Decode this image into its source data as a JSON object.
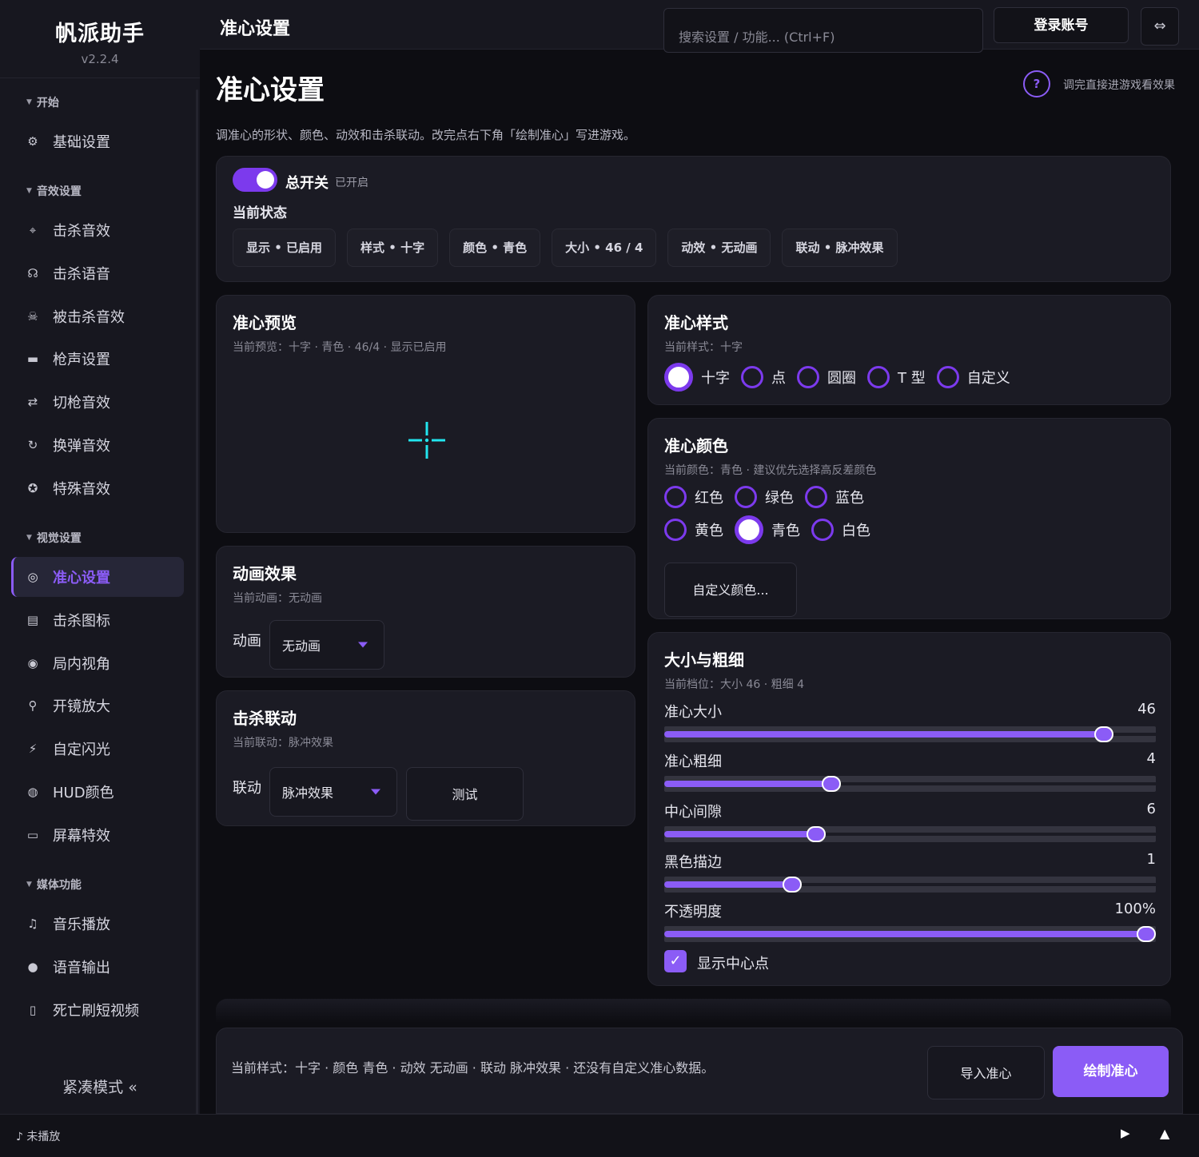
{
  "app": {
    "name": "帆派助手",
    "version": "v2.2.4"
  },
  "topbar": {
    "title": "准心设置",
    "search_placeholder": "搜索设置 / 功能...  (Ctrl+F)",
    "login": "登录账号",
    "swap_icon": "⇔"
  },
  "sidebar": {
    "sections": [
      {
        "label": "开始",
        "items": [
          {
            "icon": "gear-icon",
            "glyph": "⚙",
            "label": "基础设置"
          }
        ]
      },
      {
        "label": "音效设置",
        "items": [
          {
            "icon": "target-icon",
            "glyph": "⌖",
            "label": "击杀音效"
          },
          {
            "icon": "voice-icon",
            "glyph": "☊",
            "label": "击杀语音"
          },
          {
            "icon": "skull-icon",
            "glyph": "☠",
            "label": "被击杀音效"
          },
          {
            "icon": "gun-icon",
            "glyph": "▬",
            "label": "枪声设置"
          },
          {
            "icon": "swap-icon",
            "glyph": "⇄",
            "label": "切枪音效"
          },
          {
            "icon": "reload-icon",
            "glyph": "↻",
            "label": "换弹音效"
          },
          {
            "icon": "star-icon",
            "glyph": "✪",
            "label": "特殊音效"
          }
        ]
      },
      {
        "label": "视觉设置",
        "items": [
          {
            "icon": "crosshair-icon",
            "glyph": "◎",
            "label": "准心设置",
            "active": true
          },
          {
            "icon": "image-icon",
            "glyph": "▤",
            "label": "击杀图标"
          },
          {
            "icon": "eye-icon",
            "glyph": "◉",
            "label": "局内视角"
          },
          {
            "icon": "magnify-icon",
            "glyph": "⚲",
            "label": "开镜放大"
          },
          {
            "icon": "flash-icon",
            "glyph": "⚡",
            "label": "自定闪光"
          },
          {
            "icon": "palette-icon",
            "glyph": "◍",
            "label": "HUD颜色"
          },
          {
            "icon": "monitor-icon",
            "glyph": "▭",
            "label": "屏幕特效"
          }
        ]
      },
      {
        "label": "媒体功能",
        "items": [
          {
            "icon": "music-icon",
            "glyph": "♫",
            "label": "音乐播放"
          },
          {
            "icon": "mic-icon",
            "glyph": "●",
            "label": "语音输出"
          },
          {
            "icon": "phone-icon",
            "glyph": "▯",
            "label": "死亡刷短视频"
          }
        ]
      }
    ],
    "compact_mode": "紧凑模式  «"
  },
  "page": {
    "heading": "准心设置",
    "help_icon": "?",
    "help_text": "调完直接进游戏看效果",
    "description": "调准心的形状、颜色、动效和击杀联动。改完点右下角「绘制准心」写进游戏。"
  },
  "master": {
    "label": "总开关",
    "state": "已开启",
    "enabled": true,
    "status_label": "当前状态",
    "chips": [
      "显示 • 已启用",
      "样式 • 十字",
      "颜色 • 青色",
      "大小 • 46 / 4",
      "动效 • 无动画",
      "联动 • 脉冲效果"
    ]
  },
  "preview": {
    "title": "准心预览",
    "subtitle": "当前预览：十字 · 青色 · 46/4 · 显示已启用",
    "color": "#22e5ee"
  },
  "style": {
    "title": "准心样式",
    "subtitle": "当前样式：十字",
    "options": [
      "十字",
      "点",
      "圆圈",
      "T 型",
      "自定义"
    ],
    "selected": "十字"
  },
  "color": {
    "title": "准心颜色",
    "subtitle": "当前颜色：青色 · 建议优先选择高反差颜色",
    "row1": [
      "红色",
      "绿色",
      "蓝色"
    ],
    "row2": [
      "黄色",
      "青色",
      "白色"
    ],
    "selected": "青色",
    "custom_button": "自定义颜色..."
  },
  "animation": {
    "title": "动画效果",
    "subtitle": "当前动画：无动画",
    "field_label": "动画",
    "value": "无动画"
  },
  "kill_link": {
    "title": "击杀联动",
    "subtitle": "当前联动：脉冲效果",
    "field_label": "联动",
    "value": "脉冲效果",
    "test_button": "测试"
  },
  "size": {
    "title": "大小与粗细",
    "subtitle": "当前档位：大小 46 · 粗细 4",
    "sliders": [
      {
        "name": "准心大小",
        "value": "46",
        "fraction": 0.895
      },
      {
        "name": "准心粗细",
        "value": "4",
        "fraction": 0.34
      },
      {
        "name": "中心间隙",
        "value": "6",
        "fraction": 0.309
      },
      {
        "name": "黑色描边",
        "value": "1",
        "fraction": 0.26
      },
      {
        "name": "不透明度",
        "value": "100%",
        "fraction": 0.98
      }
    ],
    "show_center_dot_label": "显示中心点",
    "show_center_dot": true
  },
  "footer": {
    "summary": "当前样式：十字 · 颜色 青色 · 动效 无动画 · 联动 脉冲效果 · 还没有自定义准心数据。",
    "import_button": "导入准心",
    "draw_button": "绘制准心"
  },
  "player": {
    "status": "♪ 未播放",
    "play_icon": "▶",
    "expand_icon": "▲"
  },
  "colors": {
    "accent": "#8b5cf6",
    "accent_dark": "#7c3aed",
    "crosshair": "#22e5ee"
  }
}
